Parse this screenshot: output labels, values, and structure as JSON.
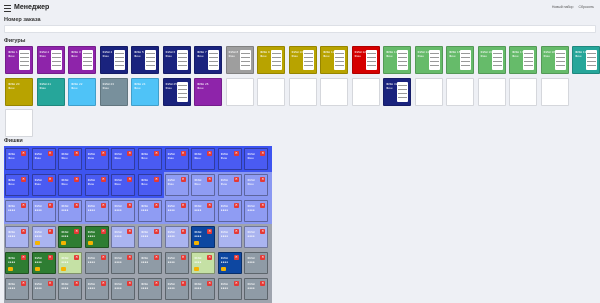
{
  "header": {
    "title": "Менеджер",
    "links": [
      "Новый набор",
      "Сбросить"
    ]
  },
  "task": {
    "label": "Номер заказа",
    "value": "",
    "placeholder": ""
  },
  "games": {
    "title": "Фигуры",
    "items": [
      {
        "text": "ФИШ 1\nФиш",
        "color": "#8e24aa",
        "panel": true
      },
      {
        "text": "ФИШ 2\nФиш",
        "color": "#8e24aa",
        "panel": true
      },
      {
        "text": "ФИШ 3\nФиш",
        "color": "#8e24aa",
        "panel": true
      },
      {
        "text": "ФИШ 4\nФиш",
        "color": "#1a237e",
        "panel": true
      },
      {
        "text": "ФИШ 5\nФиш",
        "color": "#1a237e",
        "panel": true
      },
      {
        "text": "ФИШ 6\nФиш",
        "color": "#1a237e",
        "panel": true
      },
      {
        "text": "ФИШ 7\nФиш",
        "color": "#1a237e",
        "panel": true
      },
      {
        "text": "ФИШ 8\nФиш",
        "color": "#9e9e9e",
        "panel": true
      },
      {
        "text": "ФИШ 9\nФиш",
        "color": "#b8a300",
        "panel": true
      },
      {
        "text": "ФИШ 10\nФиш",
        "color": "#b8a300",
        "panel": true
      },
      {
        "text": "ФИШ 11\nФиш",
        "color": "#b8a300",
        "panel": true
      },
      {
        "text": "ФИШ 12\nФиш",
        "color": "#d50000",
        "panel": true
      },
      {
        "text": "ФИШ 13\nФиш",
        "color": "#66bb6a",
        "panel": true
      },
      {
        "text": "ФИШ 14\nФиш",
        "color": "#66bb6a",
        "panel": true
      },
      {
        "text": "ФИШ 15\nФиш",
        "color": "#66bb6a",
        "panel": true
      },
      {
        "text": "ФИШ 16\nФиш",
        "color": "#66bb6a",
        "panel": true
      },
      {
        "text": "ФИШ 17\nФиш",
        "color": "#66bb6a",
        "panel": true
      },
      {
        "text": "ФИШ 18\nФиш",
        "color": "#66bb6a",
        "panel": true
      },
      {
        "text": "ФИШ 19\nФиш",
        "color": "#26a69a",
        "panel": true
      },
      {
        "text": "ФИШ 20\nФиш",
        "color": "#b8a300",
        "panel": false
      },
      {
        "text": "ФИШ 21\nФиш",
        "color": "#26a69a",
        "panel": false
      },
      {
        "text": "ФИШ 22\nФиш",
        "color": "#4fc3f7",
        "panel": false
      },
      {
        "text": "ФИШ 23\nФиш",
        "color": "#78909c",
        "panel": false
      },
      {
        "text": "ФИШ 24\nФиш",
        "color": "#4fc3f7",
        "panel": false
      },
      {
        "text": "ФИШ 25\nФиш",
        "color": "#1a237e",
        "panel": true
      },
      {
        "text": "ФИШ 26\nФиш",
        "color": "#8e24aa",
        "panel": false
      },
      {
        "text": "",
        "color": "#ffffff",
        "panel": false
      },
      {
        "text": "",
        "color": "#ffffff",
        "panel": false
      },
      {
        "text": "",
        "color": "#ffffff",
        "panel": false
      },
      {
        "text": "",
        "color": "#ffffff",
        "panel": false
      },
      {
        "text": "",
        "color": "#ffffff",
        "panel": false
      },
      {
        "text": "ФИШ 32\nФиш",
        "color": "#1a237e",
        "panel": true
      },
      {
        "text": "",
        "color": "#ffffff",
        "panel": false
      },
      {
        "text": "",
        "color": "#ffffff",
        "panel": false
      },
      {
        "text": "",
        "color": "#ffffff",
        "panel": false
      },
      {
        "text": "",
        "color": "#ffffff",
        "panel": false
      },
      {
        "text": "",
        "color": "#ffffff",
        "panel": false
      }
    ]
  },
  "chips": {
    "title": "Фишки",
    "rows": [
      [
        {
          "text": "ФИШ\nФиш",
          "color": "#4a5bf2",
          "del": "✕"
        },
        {
          "text": "ФИШ\nФиш",
          "color": "#4a5bf2",
          "del": "✕"
        },
        {
          "text": "ФИШ\nФиш",
          "color": "#4a5bf2",
          "del": "✕"
        },
        {
          "text": "ФИШ\nФиш",
          "color": "#4a5bf2",
          "del": "✕"
        },
        {
          "text": "ФИШ\nФиш",
          "color": "#4a5bf2",
          "del": "✕"
        },
        {
          "text": "ФИШ\nФиш",
          "color": "#4a5bf2",
          "del": "✕"
        },
        {
          "text": "ФИШ\nФиш",
          "color": "#4a5bf2",
          "del": "✕"
        },
        {
          "text": "ФИШ\nФиш",
          "color": "#4a5bf2",
          "del": "✕"
        },
        {
          "text": "ФИШ\nФиш",
          "color": "#4a5bf2",
          "del": "✕"
        },
        {
          "text": "ФИШ\nФиш",
          "color": "#4a5bf2",
          "del": "✕"
        }
      ],
      [
        {
          "text": "ФИШ\nФиш",
          "color": "#4a5bf2",
          "del": "✕"
        },
        {
          "text": "ФИШ\nФиш",
          "color": "#4a5bf2",
          "del": "✕"
        },
        {
          "text": "ФИШ\nФиш",
          "color": "#4a5bf2",
          "del": "✕"
        },
        {
          "text": "ФИШ\nФиш",
          "color": "#4a5bf2",
          "del": "✕"
        },
        {
          "text": "ФИШ\nФиш",
          "color": "#4a5bf2",
          "del": "✕"
        },
        {
          "text": "ФИШ\nФиш",
          "color": "#4a5bf2",
          "del": "✕"
        },
        {
          "text": "ФИШ\nФиш",
          "color": "#8f9cf3",
          "del": "✕"
        },
        {
          "text": "ФИШ\nФиш",
          "color": "#8f9cf3",
          "del": "✕"
        },
        {
          "text": "ФИШ\nФиш",
          "color": "#8f9cf3",
          "del": "✕"
        },
        {
          "text": "ФИШ\nФиш",
          "color": "#8f9cf3",
          "del": "✕"
        }
      ],
      [
        {
          "text": "ФИШ\n●●●●",
          "color": "#8f9cf3",
          "del": "✕"
        },
        {
          "text": "ФИШ\n●●●●",
          "color": "#8f9cf3",
          "del": "✕"
        },
        {
          "text": "ФИШ\n●●●●",
          "color": "#8f9cf3",
          "del": "✕"
        },
        {
          "text": "ФИШ\n●●●●",
          "color": "#8f9cf3",
          "del": "✕"
        },
        {
          "text": "ФИШ\n●●●●",
          "color": "#8f9cf3",
          "del": "✕"
        },
        {
          "text": "ФИШ\n●●●●",
          "color": "#8f9cf3",
          "del": "✕"
        },
        {
          "text": "ФИШ\n●●●●",
          "color": "#8f9cf3",
          "del": "✕"
        },
        {
          "text": "ФИШ\n●●●●",
          "color": "#8f9cf3",
          "del": "✕"
        },
        {
          "text": "ФИШ\n●●●●",
          "color": "#8f9cf3",
          "del": "✕"
        },
        {
          "text": "ФИШ\n●●●●",
          "color": "#8f9cf3",
          "del": "✕"
        }
      ],
      [
        {
          "text": "ФИШ\n●●●●",
          "color": "#aab4f0",
          "del": "✕"
        },
        {
          "text": "ФИШ\n●●●●",
          "color": "#aab4f0",
          "del": "✕",
          "tag": true
        },
        {
          "text": "ФИШ\n●●●●",
          "color": "#2e7d32",
          "del": "✕",
          "tag": true
        },
        {
          "text": "ФИШ\n●●●●",
          "color": "#2e7d32",
          "del": "✕",
          "tag": true
        },
        {
          "text": "ФИШ\n●●●●",
          "color": "#aab4f0",
          "del": "✕"
        },
        {
          "text": "ФИШ\n●●●●",
          "color": "#aab4f0",
          "del": "✕"
        },
        {
          "text": "ФИШ\n●●●●",
          "color": "#aab4f0",
          "del": "✕"
        },
        {
          "text": "ФИШ\n●●●●",
          "color": "#0d47a1",
          "del": "✕",
          "tag": true
        },
        {
          "text": "ФИШ\n●●●●",
          "color": "#aab4f0",
          "del": "✕"
        },
        {
          "text": "ФИШ\n●●●●",
          "color": "#aab4f0",
          "del": "✕"
        }
      ],
      [
        {
          "text": "ФИШ\n●●●●",
          "color": "#2e7d32",
          "del": "✕",
          "tag": true
        },
        {
          "text": "ФИШ\n●●●●",
          "color": "#2e7d32",
          "del": "✕",
          "tag": true
        },
        {
          "text": "ФИШ\n●●●●",
          "color": "#c5e1a5",
          "del": "✕",
          "tag": true
        },
        {
          "text": "ФИШ\n●●●●",
          "color": "#8f9ba6",
          "del": "✕"
        },
        {
          "text": "ФИШ\n●●●●",
          "color": "#8f9ba6",
          "del": "✕"
        },
        {
          "text": "ФИШ\n●●●●",
          "color": "#8f9ba6",
          "del": "✕"
        },
        {
          "text": "ФИШ\n●●●●",
          "color": "#8f9ba6",
          "del": "✕"
        },
        {
          "text": "ФИШ\n●●●●",
          "color": "#c5e1a5",
          "del": "✕",
          "tag": true
        },
        {
          "text": "ФИШ\n●●●●",
          "color": "#0d47a1",
          "del": "✕",
          "tag": true
        },
        {
          "text": "ФИШ\n●●●●",
          "color": "#8f9ba6",
          "del": "✕"
        }
      ],
      [
        {
          "text": "ФИШ\n●●●●",
          "color": "#8f9ba6",
          "del": "✕"
        },
        {
          "text": "ФИШ\n●●●●",
          "color": "#8f9ba6",
          "del": "✕"
        },
        {
          "text": "ФИШ\n●●●●",
          "color": "#8f9ba6",
          "del": "✕"
        },
        {
          "text": "ФИШ\n●●●●",
          "color": "#8f9ba6",
          "del": "✕"
        },
        {
          "text": "ФИШ\n●●●●",
          "color": "#8f9ba6",
          "del": "✕"
        },
        {
          "text": "ФИШ\n●●●●",
          "color": "#8f9ba6",
          "del": "✕"
        },
        {
          "text": "ФИШ\n●●●●",
          "color": "#8f9ba6",
          "del": "✕"
        },
        {
          "text": "ФИШ\n●●●●",
          "color": "#8f9ba6",
          "del": "✕"
        },
        {
          "text": "ФИШ\n●●●●",
          "color": "#8f9ba6",
          "del": "✕"
        },
        {
          "text": "ФИШ\n●●●●",
          "color": "#8f9ba6",
          "del": "✕"
        }
      ]
    ]
  }
}
